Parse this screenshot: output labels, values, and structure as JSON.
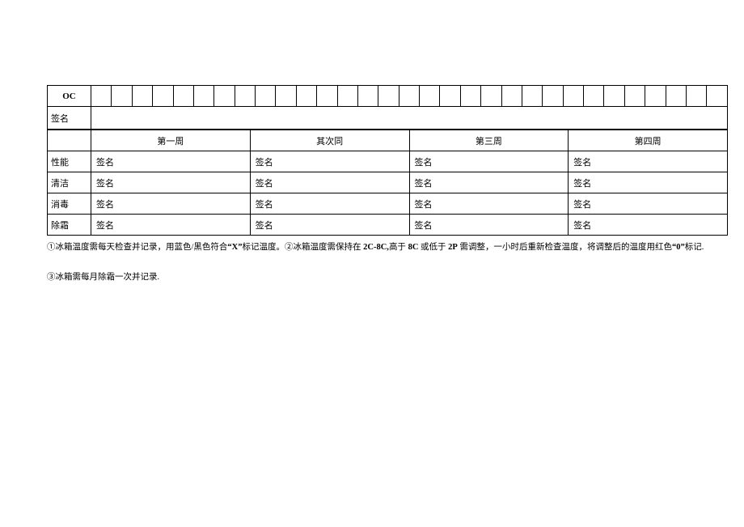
{
  "topTable": {
    "ocLabel": "OC",
    "signatureLabel": "签名"
  },
  "weekHeaders": [
    "第一周",
    "其次同",
    "第三周",
    "第四周"
  ],
  "maintRows": [
    {
      "label": "性能",
      "cellLabel": "签名"
    },
    {
      "label": "清洁",
      "cellLabel": "签名"
    },
    {
      "label": "消毒",
      "cellLabel": "签名"
    },
    {
      "label": "除霜",
      "cellLabel": "签名"
    }
  ],
  "notes": {
    "line1_pre": "①冰箱温度需每天检查并记录，用蓝色/黑色符合",
    "line1_x": "“X”",
    "line1_mid1": "标记温度。②冰箱温度需保持在 ",
    "line1_b1": "2C-8C,",
    "line1_mid2": "高于 ",
    "line1_b2": "8C",
    "line1_mid3": " 或低于 ",
    "line1_b3": "2P",
    "line1_mid4": " 需调整，一小时后重新检查温度，将调整后的温度用红色",
    "line1_b4": "“0”",
    "line1_end": "标记.",
    "line2": "③冰箱需每月除霜一次并记录."
  }
}
